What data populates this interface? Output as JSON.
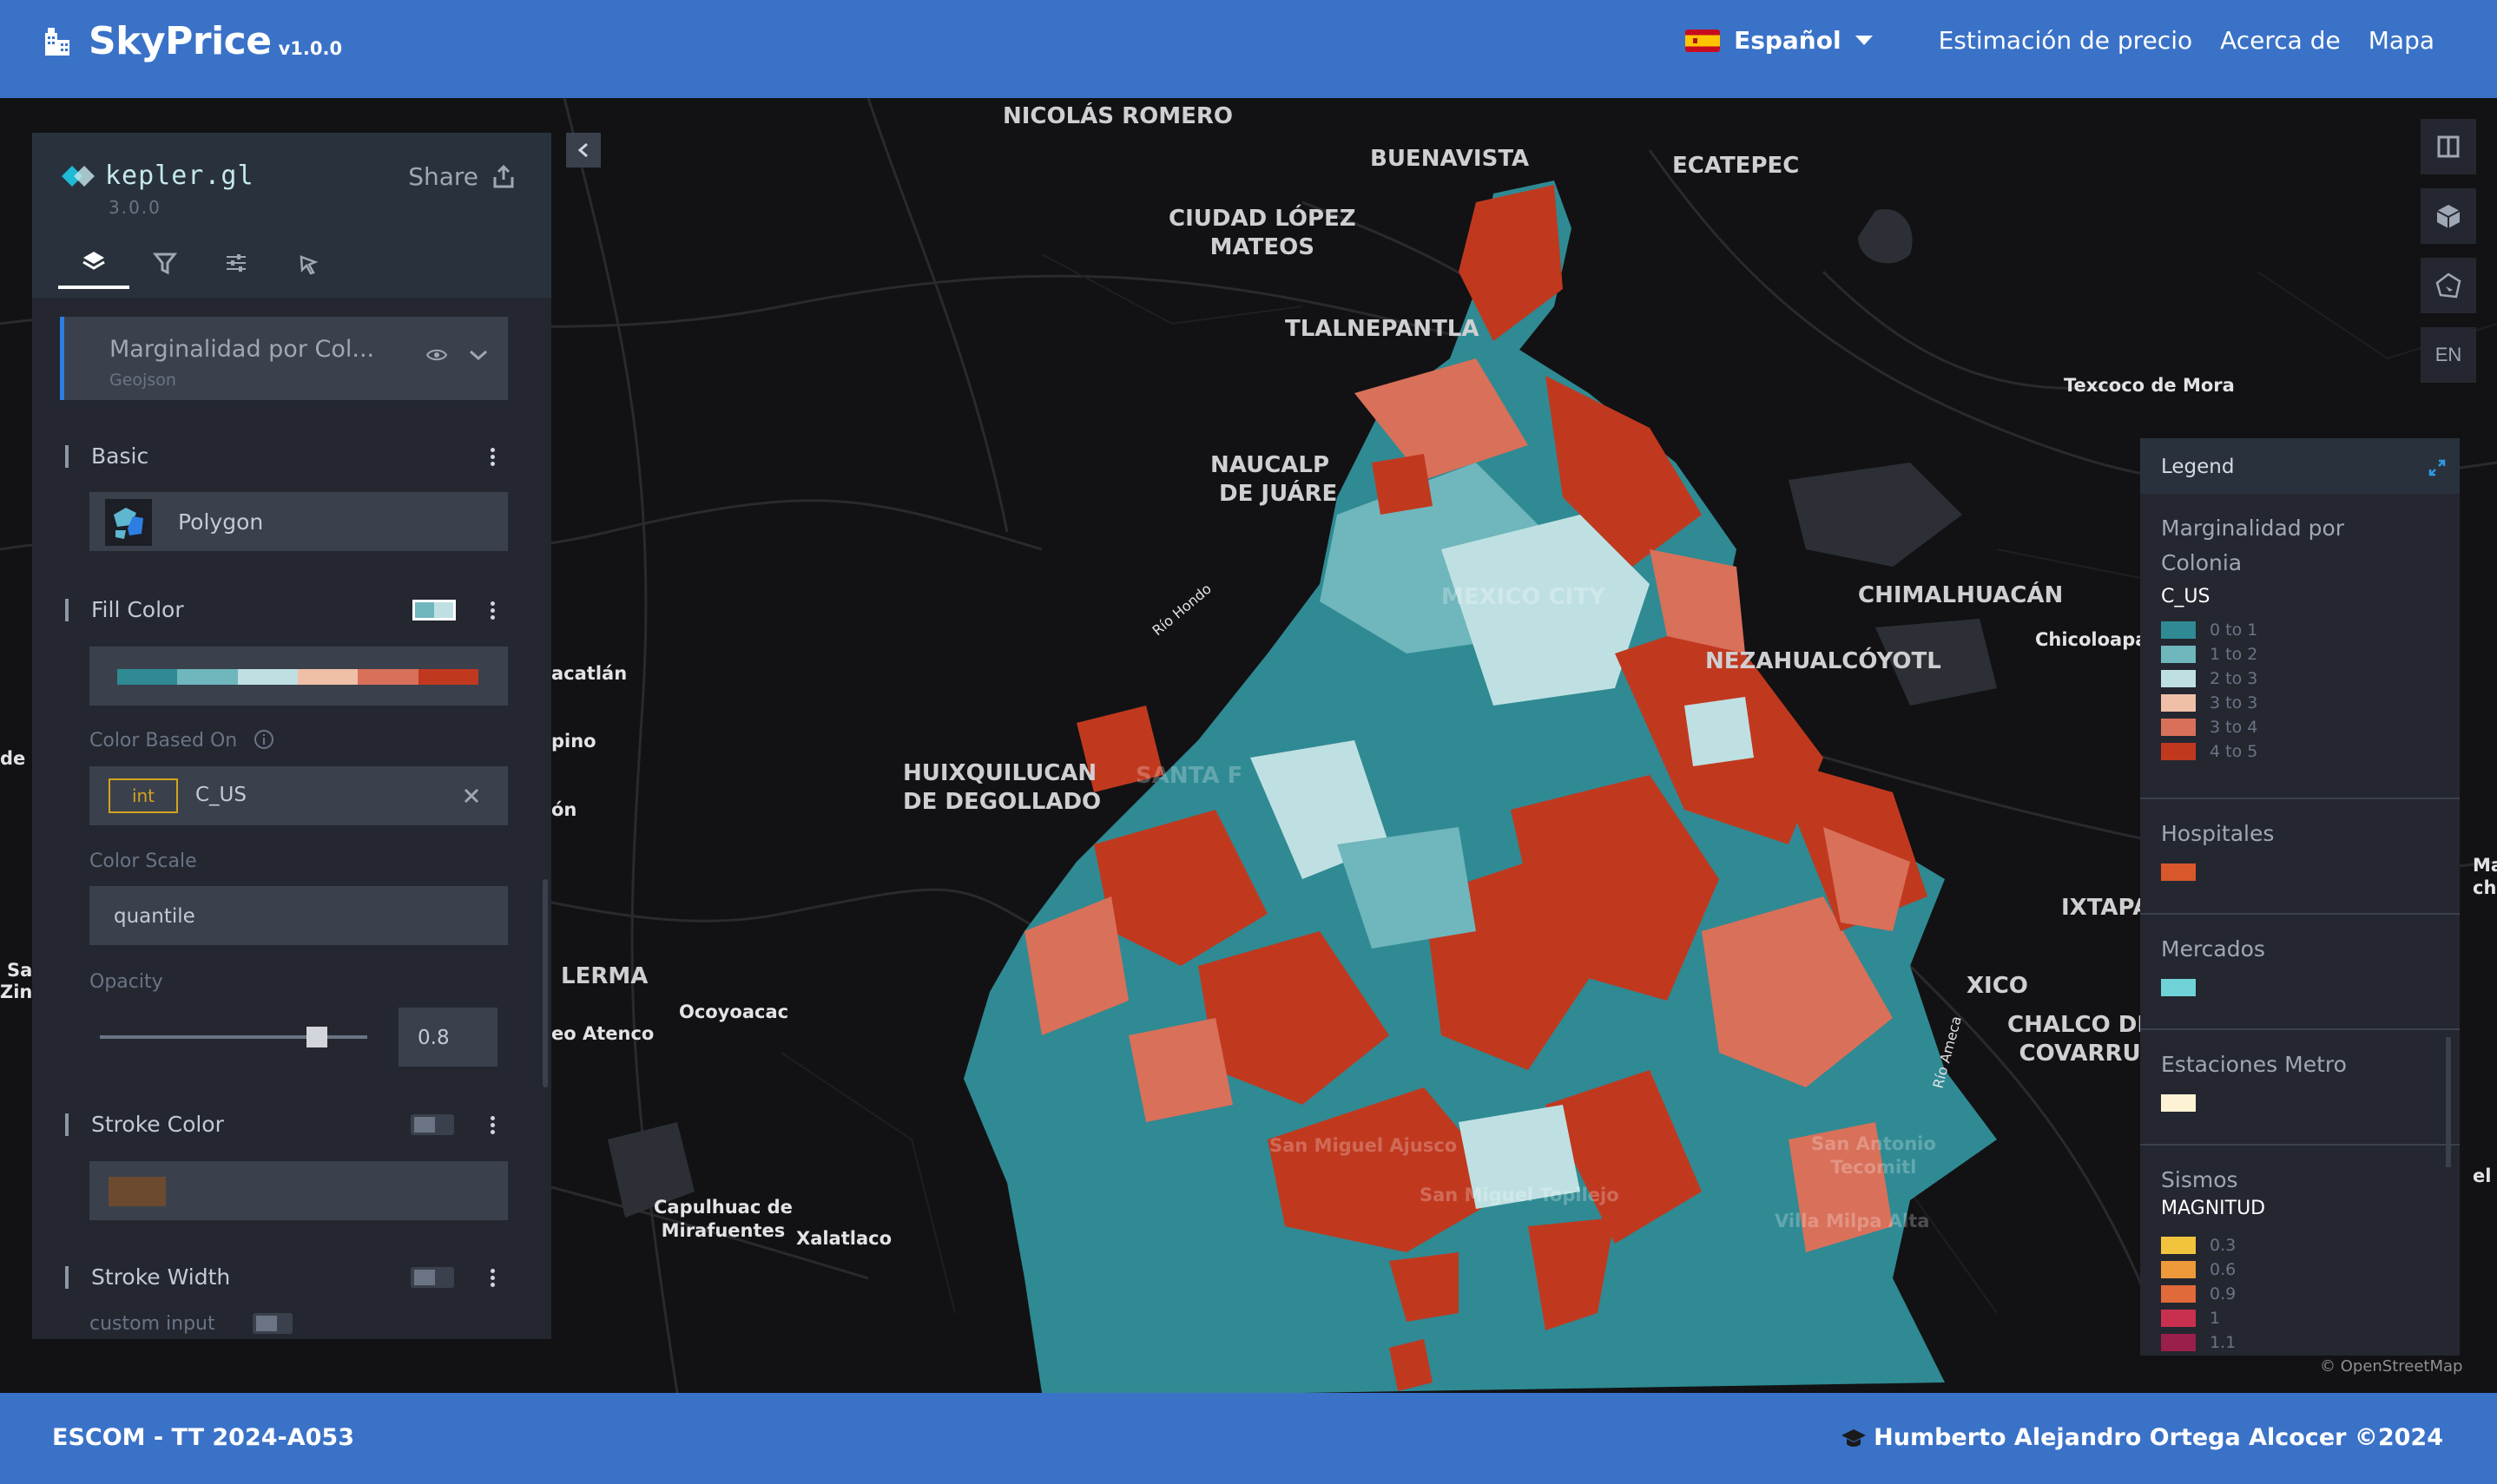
{
  "header": {
    "brand": "SkyPrice",
    "version": "v1.0.0",
    "language": "Español",
    "nav": [
      "Estimación de precio",
      "Acerca de",
      "Mapa"
    ]
  },
  "kepler": {
    "name": "kepler.gl",
    "version": "3.0.0",
    "share_label": "Share",
    "layer": {
      "title": "Marginalidad por Col...",
      "type": "Geojson"
    },
    "basic_label": "Basic",
    "polygon_label": "Polygon",
    "fill_color_label": "Fill Color",
    "color_based_on_label": "Color Based On",
    "field_type": "int",
    "field_name": "C_US",
    "color_scale_label": "Color Scale",
    "color_scale_value": "quantile",
    "opacity_label": "Opacity",
    "opacity_value": "0.8",
    "stroke_color_label": "Stroke Color",
    "stroke_width_label": "Stroke Width",
    "custom_input_label": "custom input",
    "fill_palette": [
      "#2f8a93",
      "#6fb6bd",
      "#bfe0e2",
      "#f0bfa8",
      "#d9705a",
      "#c0391f"
    ],
    "stroke_color": "#6b4a30"
  },
  "map": {
    "places": {
      "nicolas_romero": "NICOLÁS ROMERO",
      "buenavista": "BUENAVISTA",
      "ecatepec": "ECATEPEC",
      "ciudad_lopez_1": "CIUDAD LÓPEZ",
      "ciudad_lopez_2": "MATEOS",
      "tlalnepantla": "TLALNEPANTLA",
      "texcoco": "Texcoco de Mora",
      "naucalpan_1": "NAUCALP",
      "naucalpan_2": "DE JUÁRE",
      "chimalhuacan": "CHIMALHUACÁN",
      "chicoloapan": "Chicoloapa",
      "nezahualcoyotl": "NEZAHUALCÓYOTL",
      "acatlan": "acatlán",
      "pino": "pino",
      "de": "de",
      "huixquilucan_1": "HUIXQUILUCAN",
      "huixquilucan_2": "DE DEGOLLADO",
      "on": "ón",
      "lerma": "LERMA",
      "ocoyoacac": "Ocoyoacac",
      "atenco": "eo Atenco",
      "ixtapa": "IXTAPA",
      "xico": "XICO",
      "chalco_1": "CHALCO DE",
      "chalco_2": "COVARRU",
      "capulhuac_1": "Capulhuac de",
      "capulhuac_2": "Mirafuentes",
      "xalatlaco": "Xalatlaco",
      "mexico_city": "MEXICO CITY",
      "santa_fe": "SANTA F",
      "rio_hondo": "Río Hondo",
      "rio_ameca": "Río Ameca",
      "san_miguel_ajusco": "San Miguel Ajusco",
      "san_miguel_topilejo": "San Miguel Topilejo",
      "san_antonio_1": "San Antonio",
      "san_antonio_2": "Tecomitl",
      "villa_milpa": "Villa Milpa Alta",
      "sa": "Sa",
      "zina": "Zina",
      "ma": "Ma",
      "che": "che",
      "el": "el"
    },
    "attribution": "© OpenStreetMap",
    "lang_button": "EN"
  },
  "legend": {
    "title": "Legend",
    "layers": [
      {
        "name": "Marginalidad por Colonia",
        "field": "C_US",
        "items": [
          {
            "label": "0 to 1",
            "color": "#2f8a93"
          },
          {
            "label": "1 to 2",
            "color": "#6fb6bd"
          },
          {
            "label": "2 to 3",
            "color": "#bfe0e2"
          },
          {
            "label": "3 to 3",
            "color": "#f0bfa8"
          },
          {
            "label": "3 to 4",
            "color": "#d9705a"
          },
          {
            "label": "4 to 5",
            "color": "#c0391f"
          }
        ]
      },
      {
        "name": "Hospitales",
        "color": "#d9582b"
      },
      {
        "name": "Mercados",
        "color": "#6fd3d8"
      },
      {
        "name": "Estaciones Metro",
        "color": "#fdf2d4"
      },
      {
        "name": "Sismos",
        "field": "MAGNITUD",
        "items": [
          {
            "label": "0.3",
            "color": "#f2c43d"
          },
          {
            "label": "0.6",
            "color": "#ee9a3a"
          },
          {
            "label": "0.9",
            "color": "#e06a3a"
          },
          {
            "label": "1",
            "color": "#c93050"
          },
          {
            "label": "1.1",
            "color": "#9a1f4a"
          }
        ]
      }
    ]
  },
  "footer": {
    "left": "ESCOM - TT 2024-A053",
    "right": "Humberto Alejandro Ortega Alcocer ©2024"
  }
}
